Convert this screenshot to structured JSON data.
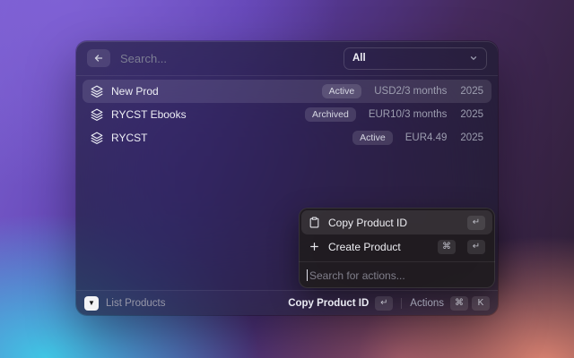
{
  "window_search": {
    "placeholder": "Search...",
    "filter_selected": "All"
  },
  "products": [
    {
      "title": "New Prod",
      "status": "Active",
      "price": "USD2/3 months",
      "year": "2025",
      "selected": true
    },
    {
      "title": "RYCST Ebooks",
      "status": "Archived",
      "price": "EUR10/3 months",
      "year": "2025",
      "selected": false
    },
    {
      "title": "RYCST",
      "status": "Active",
      "price": "EUR4.49",
      "year": "2025",
      "selected": false
    }
  ],
  "action_panel": {
    "items": [
      {
        "label": "Copy Product ID",
        "icon": "clipboard-icon",
        "keys": [
          "↵"
        ],
        "selected": true
      },
      {
        "label": "Create Product",
        "icon": "plus-icon",
        "keys": [
          "⌘",
          "↵"
        ],
        "selected": false
      }
    ],
    "search_placeholder": "Search for actions..."
  },
  "footer": {
    "extension_label": "List Products",
    "primary_action": {
      "label": "Copy Product ID",
      "key": "↵"
    },
    "actions": {
      "label": "Actions",
      "keys": [
        "⌘",
        "K"
      ]
    }
  },
  "icons": {
    "back": "arrow-left-icon",
    "filter": "chevron-down-icon",
    "product_row": "layers-icon",
    "logo_glyph": "▼"
  },
  "colors": {
    "bg_top_left": "#7a5ece",
    "bg_bottom_left": "#3ecee8",
    "bg_bottom_right": "#e48874",
    "bg_top_right": "#2d1e33",
    "panel": "rgba(26,27,44,0.66)",
    "row_selected": "rgba(255,255,255,0.10)",
    "badge_bg": "rgba(255,255,255,0.13)"
  }
}
